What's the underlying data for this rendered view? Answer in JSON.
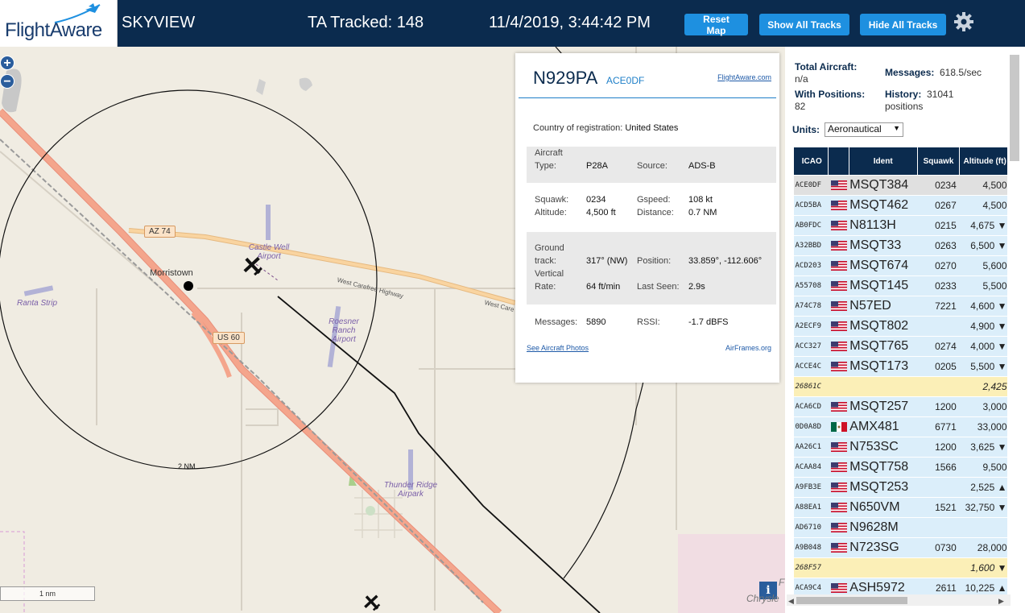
{
  "header": {
    "logo_text": "FlightAware",
    "app_name": "SKYVIEW",
    "tracked_label": "TA Tracked: 148",
    "datetime": "11/4/2019, 3:44:42 PM",
    "buttons": {
      "reset_map": "Reset Map",
      "show_all": "Show All Tracks",
      "hide_all": "Hide All Tracks"
    }
  },
  "map": {
    "zoom_in": "+",
    "zoom_out": "−",
    "town_label": "Morristown",
    "shields": {
      "az74": "AZ 74",
      "us60": "US 60"
    },
    "roads": {
      "west_carefree": "West Carefree Highway",
      "west_care": "West Care"
    },
    "airports": {
      "castle_well": "Castle Well Airport",
      "ranta_strip": "Ranta Strip",
      "roesner_ranch": "Roesner Ranch Airport",
      "thunder_ridge": "Thunder Ridge Airpark"
    },
    "range_label": "2 NM",
    "scale_label": "1 nm",
    "info_button": "i",
    "edge_text_f": "F",
    "edge_text_chrysle": "Chrysle"
  },
  "popup": {
    "registration": "N929PA",
    "hex": "ACE0DF",
    "fa_link": "FlightAware.com",
    "country_label": "Country of registration:",
    "country_value": "United States",
    "aircraft_type_label": "Aircraft Type:",
    "aircraft_type_value": "P28A",
    "source_label": "Source:",
    "source_value": "ADS-B",
    "squawk_label": "Squawk:",
    "squawk_value": "0234",
    "gspeed_label": "Gspeed:",
    "gspeed_value": "108 kt",
    "altitude_label": "Altitude:",
    "altitude_value": "4,500 ft",
    "distance_label": "Distance:",
    "distance_value": "0.7 NM",
    "ground_track_label": "Ground track:",
    "ground_track_value": "317° (NW)",
    "position_label": "Position:",
    "position_value": "33.859°, -112.606°",
    "vertical_rate_label": "Vertical Rate:",
    "vertical_rate_value": "64 ft/min",
    "last_seen_label": "Last Seen:",
    "last_seen_value": "2.9s",
    "messages_label": "Messages:",
    "messages_value": "5890",
    "rssi_label": "RSSI:",
    "rssi_value": "-1.7 dBFS",
    "photos_link": "See Aircraft Photos",
    "airframes_link": "AirFrames.org"
  },
  "panel": {
    "total_aircraft_label": "Total Aircraft:",
    "total_aircraft_value": "n/a",
    "with_positions_label": "With Positions:",
    "with_positions_value": "82",
    "messages_label": "Messages:",
    "messages_value": "618.5/sec",
    "history_label": "History:",
    "history_value": "31041 positions",
    "units_label": "Units:",
    "units_value": "Aeronautical"
  },
  "table": {
    "columns": [
      "ICAO",
      "",
      "Ident",
      "Squawk",
      "Altitude (ft)"
    ],
    "rows": [
      {
        "icao": "ACE0DF",
        "flag": "us",
        "ident": "MSQT384",
        "squawk": "0234",
        "alt": "4,500",
        "state": "sel"
      },
      {
        "icao": "ACD5BA",
        "flag": "us",
        "ident": "MSQT462",
        "squawk": "0267",
        "alt": "4,500",
        "state": ""
      },
      {
        "icao": "AB0FDC",
        "flag": "us",
        "ident": "N8113H",
        "squawk": "0215",
        "alt": "4,675 ▼",
        "state": ""
      },
      {
        "icao": "A32BBD",
        "flag": "us",
        "ident": "MSQT33",
        "squawk": "0263",
        "alt": "6,500 ▼",
        "state": ""
      },
      {
        "icao": "ACD203",
        "flag": "us",
        "ident": "MSQT674",
        "squawk": "0270",
        "alt": "5,600",
        "state": ""
      },
      {
        "icao": "A55708",
        "flag": "us",
        "ident": "MSQT145",
        "squawk": "0233",
        "alt": "5,500",
        "state": ""
      },
      {
        "icao": "A74C78",
        "flag": "us",
        "ident": "N57ED",
        "squawk": "7221",
        "alt": "4,600 ▼",
        "state": ""
      },
      {
        "icao": "A2ECF9",
        "flag": "us",
        "ident": "MSQT802",
        "squawk": "",
        "alt": "4,900 ▼",
        "state": ""
      },
      {
        "icao": "ACC327",
        "flag": "us",
        "ident": "MSQT765",
        "squawk": "0274",
        "alt": "4,000 ▼",
        "state": ""
      },
      {
        "icao": "ACCE4C",
        "flag": "us",
        "ident": "MSQT173",
        "squawk": "0205",
        "alt": "5,500 ▼",
        "state": ""
      },
      {
        "icao": "26861C",
        "flag": "",
        "ident": "",
        "squawk": "",
        "alt": "2,425",
        "state": "nopos"
      },
      {
        "icao": "ACA6CD",
        "flag": "us",
        "ident": "MSQT257",
        "squawk": "1200",
        "alt": "3,000",
        "state": ""
      },
      {
        "icao": "0D0A8D",
        "flag": "mx",
        "ident": "AMX481",
        "squawk": "6771",
        "alt": "33,000",
        "state": ""
      },
      {
        "icao": "AA26C1",
        "flag": "us",
        "ident": "N753SC",
        "squawk": "1200",
        "alt": "3,625 ▼",
        "state": ""
      },
      {
        "icao": "ACAA84",
        "flag": "us",
        "ident": "MSQT758",
        "squawk": "1566",
        "alt": "9,500",
        "state": ""
      },
      {
        "icao": "A9FB3E",
        "flag": "us",
        "ident": "MSQT253",
        "squawk": "",
        "alt": "2,525 ▲",
        "state": ""
      },
      {
        "icao": "A88EA1",
        "flag": "us",
        "ident": "N650VM",
        "squawk": "1521",
        "alt": "32,750 ▼",
        "state": ""
      },
      {
        "icao": "AD6710",
        "flag": "us",
        "ident": "N9628M",
        "squawk": "",
        "alt": "",
        "state": ""
      },
      {
        "icao": "A9B048",
        "flag": "us",
        "ident": "N723SG",
        "squawk": "0730",
        "alt": "28,000",
        "state": ""
      },
      {
        "icao": "268F57",
        "flag": "",
        "ident": "",
        "squawk": "",
        "alt": "1,600 ▼",
        "state": "nopos"
      },
      {
        "icao": "ACA9C4",
        "flag": "us",
        "ident": "ASH5972",
        "squawk": "2611",
        "alt": "10,225 ▲",
        "state": ""
      }
    ]
  },
  "colors": {
    "header_bg": "#0b2b4e",
    "button_bg": "#1e90e0",
    "map_bg": "#f0ece2",
    "highway": "#f4a58c",
    "route": "#f9d4a0",
    "row_bg": "#dbeefa",
    "row_nopos": "#fbefb7"
  }
}
